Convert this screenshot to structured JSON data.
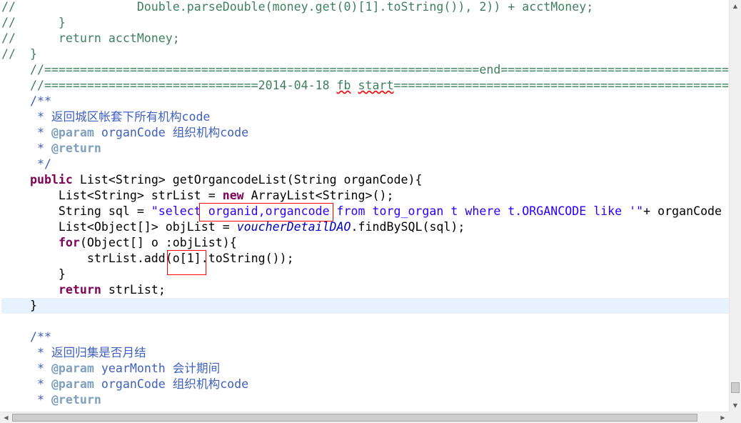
{
  "editor": {
    "lines": [
      {
        "tokens": [
          {
            "c": "comment",
            "t": "//"
          },
          {
            "c": "comment",
            "t": "                 Double.parseDouble(money.get(0)[1].toString()), 2)) + acctMoney;"
          }
        ]
      },
      {
        "tokens": [
          {
            "c": "comment",
            "t": "//"
          },
          {
            "c": "comment",
            "t": "      }"
          }
        ]
      },
      {
        "tokens": [
          {
            "c": "comment",
            "t": "//"
          },
          {
            "c": "comment",
            "t": "      return acctMoney;"
          }
        ]
      },
      {
        "tokens": [
          {
            "c": "comment",
            "t": "//"
          },
          {
            "c": "comment",
            "t": "  }"
          }
        ]
      },
      {
        "tokens": [
          {
            "c": "comment",
            "t": "    //=============================================================end========================================"
          }
        ]
      },
      {
        "tokens": [
          {
            "c": "comment",
            "t": "    //==============================2014-04-18 "
          },
          {
            "c": "comment squiggle",
            "t": "fb"
          },
          {
            "c": "comment",
            "t": " "
          },
          {
            "c": "comment squiggle",
            "t": "start"
          },
          {
            "c": "comment",
            "t": "=================================================="
          }
        ]
      },
      {
        "tokens": [
          {
            "c": "doc",
            "t": "    /**"
          }
        ]
      },
      {
        "tokens": [
          {
            "c": "doc",
            "t": "     * 返回城区帐套下所有机构code"
          }
        ]
      },
      {
        "tokens": [
          {
            "c": "doc",
            "t": "     * "
          },
          {
            "c": "doctag",
            "t": "@param"
          },
          {
            "c": "doc",
            "t": " organCode 组织机构code"
          }
        ]
      },
      {
        "tokens": [
          {
            "c": "doc",
            "t": "     * "
          },
          {
            "c": "doctag",
            "t": "@return"
          }
        ]
      },
      {
        "tokens": [
          {
            "c": "doc",
            "t": "     */"
          }
        ]
      },
      {
        "tokens": [
          {
            "c": "plain",
            "t": "    "
          },
          {
            "c": "keyword",
            "t": "public"
          },
          {
            "c": "plain",
            "t": " List<String> getOrgancodeList(String organCode){"
          }
        ]
      },
      {
        "tokens": [
          {
            "c": "plain",
            "t": "        List<String> strList = "
          },
          {
            "c": "keyword",
            "t": "new"
          },
          {
            "c": "plain",
            "t": " ArrayList<String>();"
          }
        ]
      },
      {
        "tokens": [
          {
            "c": "plain",
            "t": "        String sql = "
          },
          {
            "c": "string",
            "t": "\"select organid,organcode from torg_organ t where t.ORGANCODE like '\""
          },
          {
            "c": "plain",
            "t": "+ organCode"
          }
        ]
      },
      {
        "tokens": [
          {
            "c": "plain",
            "t": "        List<Object[]> objList = "
          },
          {
            "c": "field",
            "t": "voucherDetailDAO"
          },
          {
            "c": "plain",
            "t": ".findBySQL(sql);"
          }
        ]
      },
      {
        "tokens": [
          {
            "c": "plain",
            "t": "        "
          },
          {
            "c": "keyword",
            "t": "for"
          },
          {
            "c": "plain",
            "t": "(Object[] o :objList){"
          }
        ]
      },
      {
        "tokens": [
          {
            "c": "plain",
            "t": "            strList.add(o[1].toString());"
          }
        ]
      },
      {
        "tokens": [
          {
            "c": "plain",
            "t": "        }"
          }
        ]
      },
      {
        "tokens": [
          {
            "c": "plain",
            "t": "        "
          },
          {
            "c": "keyword",
            "t": "return"
          },
          {
            "c": "plain",
            "t": " strList;"
          }
        ]
      },
      {
        "tokens": [
          {
            "c": "plain",
            "t": "    }"
          }
        ]
      },
      {
        "tokens": []
      },
      {
        "tokens": [
          {
            "c": "doc",
            "t": "    /**"
          }
        ]
      },
      {
        "tokens": [
          {
            "c": "doc",
            "t": "     * 返回归集是否月结"
          }
        ]
      },
      {
        "tokens": [
          {
            "c": "doc",
            "t": "     * "
          },
          {
            "c": "doctag",
            "t": "@param"
          },
          {
            "c": "doc",
            "t": " yearMonth 会计期间"
          }
        ]
      },
      {
        "tokens": [
          {
            "c": "doc",
            "t": "     * "
          },
          {
            "c": "doctag",
            "t": "@param"
          },
          {
            "c": "doc",
            "t": " organCode 组织机构code"
          }
        ]
      },
      {
        "tokens": [
          {
            "c": "doc",
            "t": "     * "
          },
          {
            "c": "doctag",
            "t": "@return"
          }
        ]
      }
    ],
    "current_line_index": 19
  },
  "scrollbars": {
    "vertical_up_icon": "arrow-up-icon",
    "vertical_down_icon": "arrow-down-icon",
    "horizontal_left_icon": "arrow-left-icon",
    "horizontal_right_icon": "arrow-right-icon"
  },
  "colors": {
    "comment": "#3f7f5f",
    "javadoc": "#3f5fbf",
    "javadoc_tag": "#7f9fbf",
    "keyword": "#7f0055",
    "string": "#2a00ff",
    "field": "#0000c0",
    "current_line": "#e8f2fe",
    "annotation_box": "#ff0000"
  }
}
